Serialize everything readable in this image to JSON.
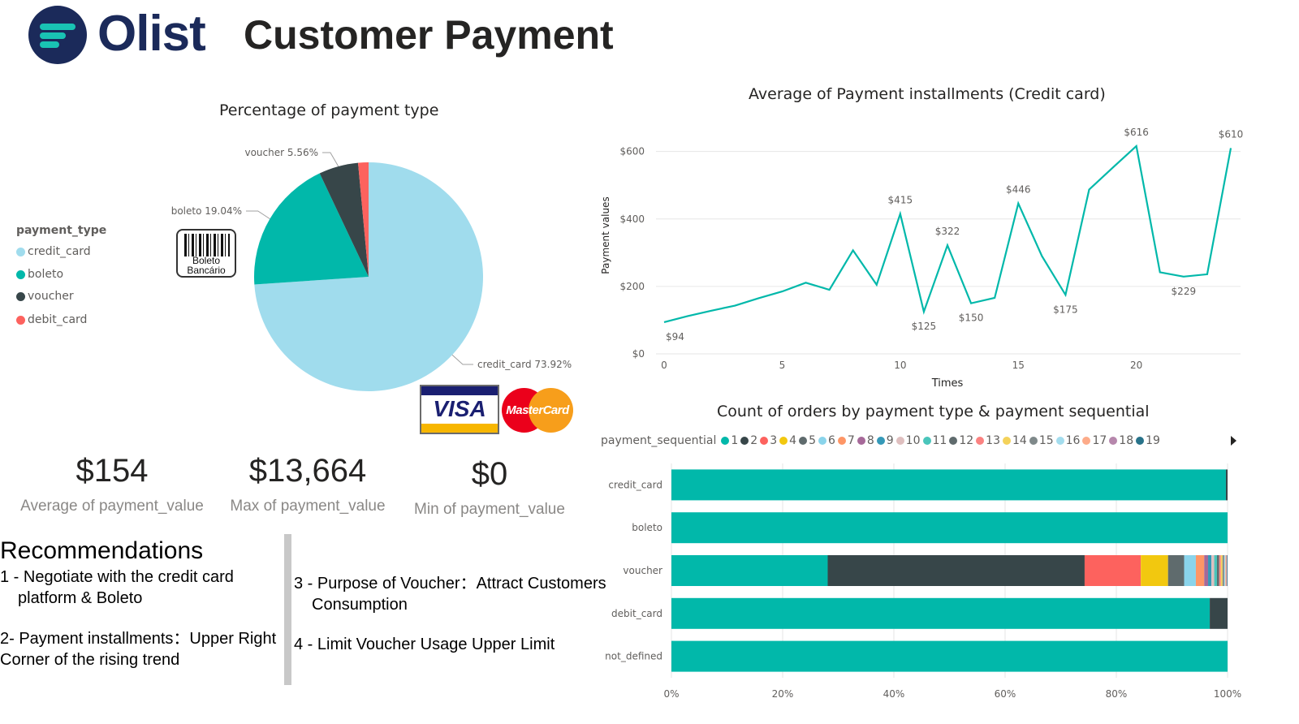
{
  "header": {
    "brand": "Olist",
    "title": "Customer Payment"
  },
  "colors": {
    "teal": "#01b8aa",
    "dark": "#374649",
    "red": "#fd625e",
    "yellow": "#f2c80f",
    "gray": "#5f6b6d",
    "lightblue": "#8ad4eb",
    "orange": "#fe9666",
    "purple": "#a66999",
    "navy": "#3599b8",
    "pie_credit": "#a0dced",
    "logo_navy": "#1b2a5a"
  },
  "pie": {
    "title": "Percentage of payment type",
    "legend_title": "payment_type",
    "legend": [
      "credit_card",
      "boleto",
      "voucher",
      "debit_card"
    ],
    "labels": {
      "voucher": "voucher 5.56%",
      "boleto": "boleto 19.04%",
      "credit_card": "credit_card 73.92%"
    }
  },
  "cards": {
    "visa": "VISA",
    "mastercard": "MasterCard",
    "boleto_line1": "Boleto",
    "boleto_line2": "Bancário"
  },
  "kpis": [
    {
      "value": "$154",
      "label": "Average of payment_value"
    },
    {
      "value": "$13,664",
      "label": "Max of payment_value"
    },
    {
      "value": "$0",
      "label": "Min of payment_value"
    }
  ],
  "recommendations": {
    "title": "Recommendations",
    "r1_line1": "1 - Negotiate with the credit card",
    "r1_line2": "platform & Boleto",
    "r2_line1": "2- Payment installments：Upper Right",
    "r2_line2": "Corner of the rising trend",
    "r3_line1": "3 - Purpose of Voucher：Attract Customers",
    "r3_line2": "Consumption",
    "r4": "4 - Limit Voucher Usage Upper Limit"
  },
  "line_chart_text": {
    "title": "Average of Payment installments (Credit card)",
    "xlabel": "Times",
    "ylabel": "Payment values"
  },
  "bar_chart_text": {
    "title": "Count of orders by payment type & payment sequential",
    "legend_title": "payment_sequential",
    "legend": [
      "1",
      "2",
      "3",
      "4",
      "5",
      "6",
      "7",
      "8",
      "9",
      "10",
      "11",
      "12",
      "13",
      "14",
      "15",
      "16",
      "17",
      "18",
      "19"
    ]
  },
  "chart_data": [
    {
      "type": "pie",
      "title": "Percentage of payment type",
      "labels": [
        "credit_card",
        "boleto",
        "voucher",
        "debit_card"
      ],
      "values": [
        73.92,
        19.04,
        5.56,
        1.47
      ]
    },
    {
      "type": "line",
      "title": "Average of Payment installments (Credit card)",
      "xlabel": "Times",
      "ylabel": "Payment values",
      "x": [
        0,
        1,
        2,
        3,
        4,
        5,
        6,
        7,
        8,
        9,
        10,
        11,
        12,
        13,
        14,
        15,
        16,
        17,
        18,
        19,
        20,
        21,
        22,
        23,
        24
      ],
      "y": [
        94,
        112,
        128,
        143,
        165,
        185,
        211,
        190,
        307,
        205,
        415,
        125,
        322,
        150,
        166,
        446,
        290,
        175,
        487,
        552,
        616,
        242,
        229,
        236,
        610
      ],
      "point_labels": {
        "0": "$94",
        "10": "$415",
        "11": "$125",
        "12": "$322",
        "13": "$150",
        "15": "$446",
        "17": "$175",
        "20": "$616",
        "22": "$229",
        "24": "$610"
      },
      "xticks": [
        0,
        5,
        10,
        15,
        20
      ],
      "yticks": [
        "$0",
        "$200",
        "$400",
        "$600"
      ],
      "ylim": [
        0,
        640
      ]
    },
    {
      "type": "bar",
      "orientation": "horizontal-stacked-100",
      "title": "Count of orders by payment type & payment sequential",
      "categories": [
        "credit_card",
        "boleto",
        "voucher",
        "debit_card",
        "not_defined"
      ],
      "xticks": [
        "0%",
        "20%",
        "40%",
        "60%",
        "80%",
        "100%"
      ],
      "series": [
        {
          "name": "1",
          "values": [
            99.7,
            100,
            28.1,
            96.8,
            100
          ]
        },
        {
          "name": "2",
          "values": [
            0.3,
            0,
            46.2,
            3.2,
            0
          ]
        },
        {
          "name": "3",
          "values": [
            0,
            0,
            10.1,
            0,
            0
          ]
        },
        {
          "name": "4",
          "values": [
            0,
            0,
            4.9,
            0,
            0
          ]
        },
        {
          "name": "5",
          "values": [
            0,
            0,
            2.9,
            0,
            0
          ]
        },
        {
          "name": "6",
          "values": [
            0,
            0,
            2.1,
            0,
            0
          ]
        },
        {
          "name": "7",
          "values": [
            0,
            0,
            1.5,
            0,
            0
          ]
        },
        {
          "name": "8",
          "values": [
            0,
            0,
            0.7,
            0,
            0
          ]
        },
        {
          "name": "9",
          "values": [
            0,
            0,
            0.6,
            0,
            0
          ]
        },
        {
          "name": "10",
          "values": [
            0,
            0,
            0.5,
            0,
            0
          ]
        },
        {
          "name": "11",
          "values": [
            0,
            0,
            0.5,
            0,
            0
          ]
        },
        {
          "name": "12",
          "values": [
            0,
            0,
            0.4,
            0,
            0
          ]
        },
        {
          "name": "13",
          "values": [
            0,
            0,
            0.3,
            0,
            0
          ]
        },
        {
          "name": "14",
          "values": [
            0,
            0,
            0.3,
            0,
            0
          ]
        },
        {
          "name": "15",
          "values": [
            0,
            0,
            0.3,
            0,
            0
          ]
        },
        {
          "name": "16",
          "values": [
            0,
            0,
            0.2,
            0,
            0
          ]
        },
        {
          "name": "17",
          "values": [
            0,
            0,
            0.2,
            0,
            0
          ]
        },
        {
          "name": "18",
          "values": [
            0,
            0,
            0.1,
            0,
            0
          ]
        },
        {
          "name": "19",
          "values": [
            0,
            0,
            0.1,
            0,
            0
          ]
        }
      ],
      "series_colors": [
        "#01b8aa",
        "#374649",
        "#fd625e",
        "#f2c80f",
        "#5f6b6d",
        "#8ad4eb",
        "#fe9666",
        "#a66999",
        "#3599b8",
        "#dfbfbf",
        "#4ac5bb",
        "#5f6b6d",
        "#fb8281",
        "#f4d25a",
        "#7f898a",
        "#a4ddee",
        "#fdab89",
        "#b687ac",
        "#28738a"
      ]
    }
  ]
}
